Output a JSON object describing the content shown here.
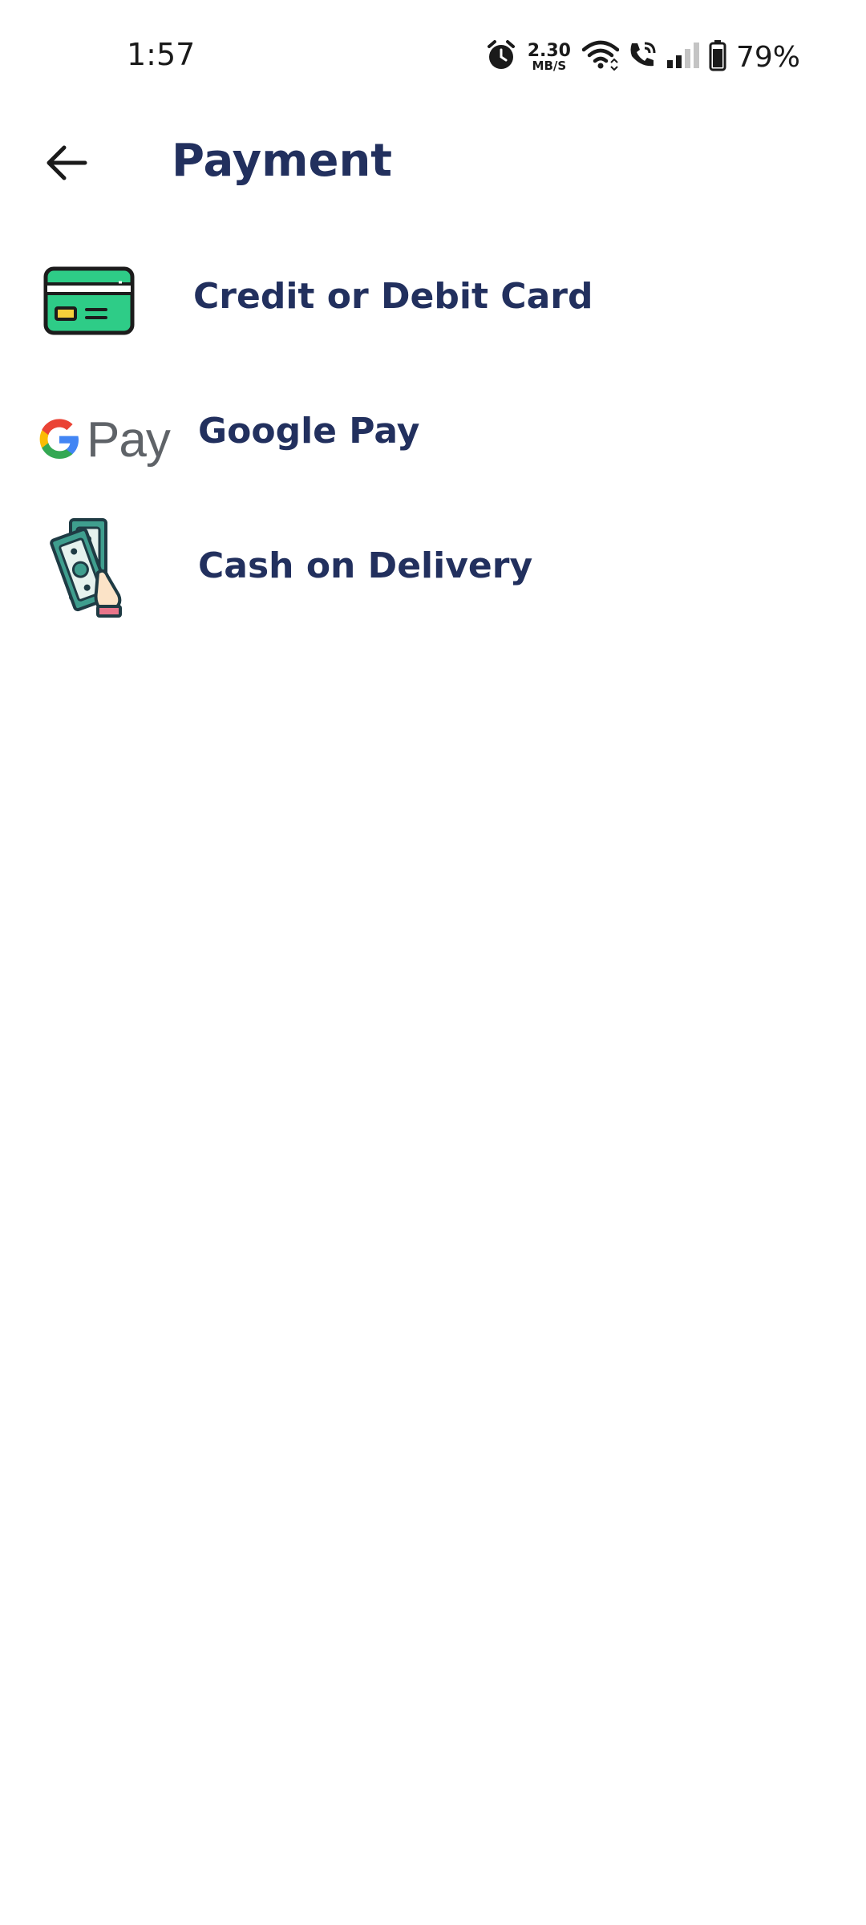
{
  "status_bar": {
    "time": "1:57",
    "net_speed_value": "2.30",
    "net_speed_unit": "MB/S",
    "battery_percent": "79%",
    "icons": [
      "alarm-icon",
      "wifi-icon",
      "wifi-calling-icon",
      "signal-icon",
      "battery-icon"
    ]
  },
  "header": {
    "title": "Payment",
    "back_icon": "arrow-left-icon"
  },
  "payment_methods": [
    {
      "label": "Credit or Debit Card",
      "icon": "credit-card-icon"
    },
    {
      "label": "Google Pay",
      "icon": "google-pay-logo",
      "logo_text": "Pay"
    },
    {
      "label": "Cash on Delivery",
      "icon": "cash-in-hand-icon"
    }
  ],
  "colors": {
    "title_text": "#22305e",
    "card_green": "#2ecc87",
    "card_chip": "#f5d03b",
    "cash_teal": "#3f9e8e",
    "background": "#ffffff"
  }
}
